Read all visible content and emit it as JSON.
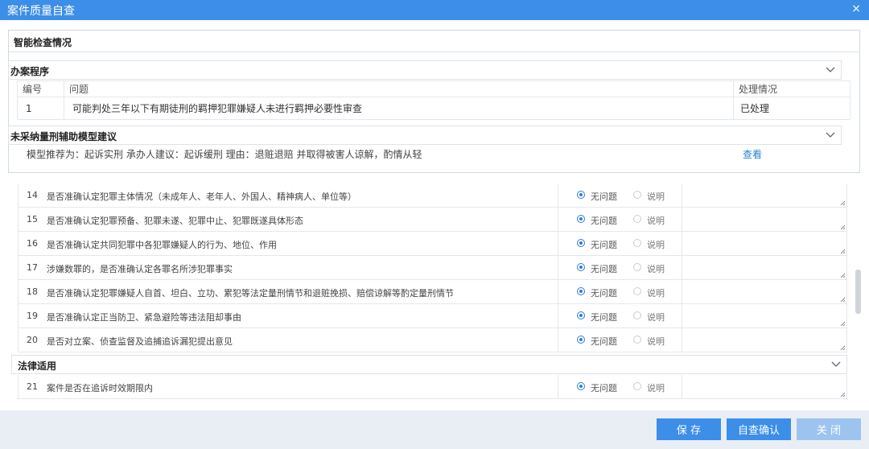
{
  "window": {
    "title": "案件质量自查",
    "close_glyph": "×"
  },
  "panel": {
    "title": "智能检查情况",
    "procedure": {
      "title": "办案程序",
      "columns": [
        "编号",
        "问题",
        "处理情况"
      ],
      "rows": [
        {
          "no": "1",
          "issue": "可能判处三年以下有期徒刑的羁押犯罪嫌疑人未进行羁押必要性审查",
          "status": "已处理"
        }
      ]
    },
    "sentencing": {
      "title": "未采纳量刑辅助模型建议",
      "advice": "模型推荐为：起诉实刑 承办人建议：起诉缓刑 理由：退赃退赔 并取得被害人谅解，酌情从轻",
      "view_label": "查看"
    }
  },
  "checklist": {
    "option_ok": "无问题",
    "option_note": "说明",
    "items": [
      {
        "no": "14",
        "question": "是否准确认定犯罪主体情况（未成年人、老年人、外国人、精神病人、单位等）",
        "selected": "无问题"
      },
      {
        "no": "15",
        "question": "是否准确认定犯罪预备、犯罪未遂、犯罪中止、犯罪既遂具体形态",
        "selected": "无问题"
      },
      {
        "no": "16",
        "question": "是否准确认定共同犯罪中各犯罪嫌疑人的行为、地位、作用",
        "selected": "无问题"
      },
      {
        "no": "17",
        "question": "涉嫌数罪的，是否准确认定各罪名所涉犯罪事实",
        "selected": "无问题"
      },
      {
        "no": "18",
        "question": "是否准确认定犯罪嫌疑人自首、坦白、立功、累犯等法定量刑情节和退赃挽损、赔偿谅解等酌定量刑情节",
        "selected": "无问题"
      },
      {
        "no": "19",
        "question": "是否准确认定正当防卫、紧急避险等违法阻却事由",
        "selected": "无问题"
      },
      {
        "no": "20",
        "question": "是否对立案、侦查监督及追捕追诉漏犯提出意见",
        "selected": "无问题"
      }
    ],
    "legal": {
      "title": "法律适用",
      "items": [
        {
          "no": "21",
          "question": "案件是否在追诉时效期限内",
          "selected": "无问题"
        }
      ]
    }
  },
  "footer": {
    "save": "保 存",
    "confirm": "自查确认",
    "close": "关 闭"
  },
  "colors": {
    "accent": "#3c8ee8",
    "link": "#2b7fd8",
    "footer_bg": "#e9eef5"
  }
}
